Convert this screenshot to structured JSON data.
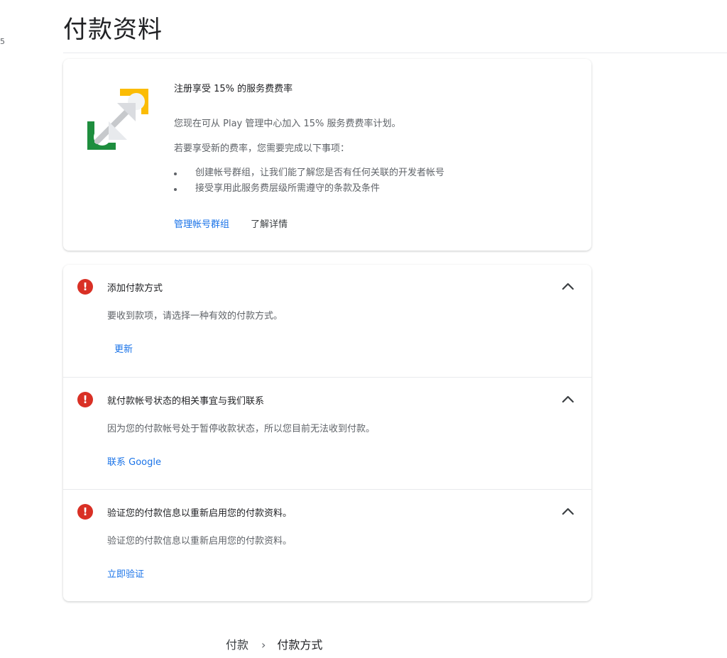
{
  "edge_number": "5",
  "page": {
    "title": "付款资料"
  },
  "promo": {
    "heading": "注册享受 15% 的服务费费率",
    "description": "您现在可从 Play 管理中心加入 15% 服务费费率计划。",
    "requirements_intro": "若要享受新的费率，您需要完成以下事项：",
    "requirements": [
      "创建帐号群组，让我们能了解您是否有任何关联的开发者帐号",
      "接受享用此服务费层级所需遵守的条款及条件"
    ],
    "primary_link": "管理帐号群组",
    "secondary_link": "了解详情",
    "icon": "play-fee-illustration-icon",
    "colors": {
      "green": "#1e8e3e",
      "yellow": "#fbbc04",
      "grey": "#c7c9cc"
    }
  },
  "alerts": [
    {
      "title": "添加付款方式",
      "description": "要收到款项，请选择一种有效的付款方式。",
      "action": "更新",
      "icon": "error-icon"
    },
    {
      "title": "就付款帐号状态的相关事宜与我们联系",
      "description": "因为您的付款帐号处于暂停收款状态，所以您目前无法收到付款。",
      "action": "联系 Google",
      "icon": "error-icon"
    },
    {
      "title": "验证您的付款信息以重新启用您的付款资料。",
      "description": "验证您的付款信息以重新启用您的付款资料。",
      "action": "立即验证",
      "icon": "error-icon"
    }
  ],
  "breadcrumb": {
    "items": [
      "付款",
      "付款方式"
    ],
    "separator": "›"
  },
  "colors": {
    "accent_blue": "#1a73e8",
    "error_red": "#d93025"
  }
}
